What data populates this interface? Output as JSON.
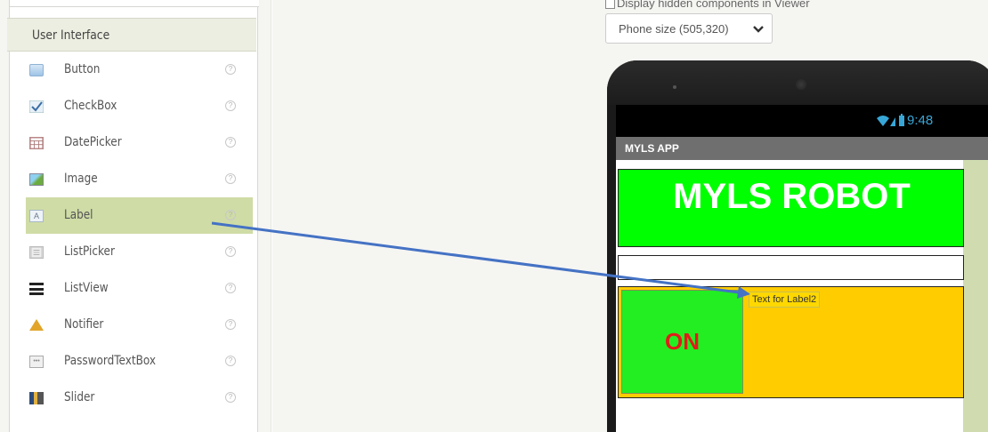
{
  "palette": {
    "header": "User Interface",
    "items": [
      {
        "label": "Button",
        "icon": "button-icon",
        "help": "?"
      },
      {
        "label": "CheckBox",
        "icon": "checkbox-icon",
        "help": "?"
      },
      {
        "label": "DatePicker",
        "icon": "datepicker-icon",
        "help": "?"
      },
      {
        "label": "Image",
        "icon": "image-icon",
        "help": "?"
      },
      {
        "label": "Label",
        "icon": "label-icon",
        "help": "?",
        "selected": true
      },
      {
        "label": "ListPicker",
        "icon": "listpicker-icon",
        "help": "?"
      },
      {
        "label": "ListView",
        "icon": "listview-icon",
        "help": "?"
      },
      {
        "label": "Notifier",
        "icon": "notifier-icon",
        "help": "?"
      },
      {
        "label": "PasswordTextBox",
        "icon": "passwordtextbox-icon",
        "help": "?"
      },
      {
        "label": "Slider",
        "icon": "slider-icon",
        "help": "?"
      }
    ],
    "label_icon_text": "A",
    "password_icon_text": "•••"
  },
  "viewer": {
    "hidden_components_label": "Display hidden components in Viewer",
    "phone_size": "Phone size (505,320)"
  },
  "phone": {
    "time": "9:48",
    "status_icons": "wifi-signal-battery-icons",
    "app_title": "MYLS APP",
    "title_label": "MYLS ROBOT",
    "textbox_value": "",
    "button_text": "ON",
    "label2_text": "Text for Label2"
  },
  "colors": {
    "title_label_bg": "#00ff00",
    "arrangement_bg": "#ffcc00",
    "button_text": "#e21b1b",
    "arrow": "#4472c4",
    "selected_row": "#cfdca6"
  }
}
